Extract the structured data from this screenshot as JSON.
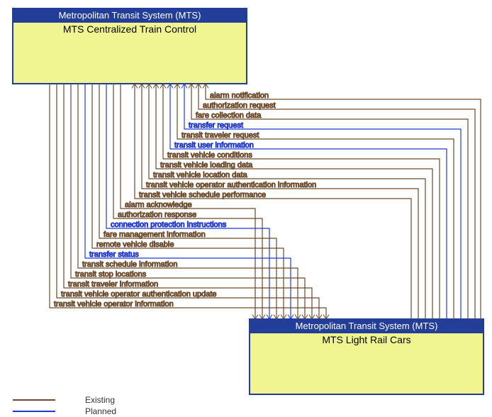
{
  "nodes": {
    "top": {
      "org": "Metropolitan Transit System (MTS)",
      "name": "MTS Centralized Train Control"
    },
    "bottom": {
      "org": "Metropolitan Transit System (MTS)",
      "name": "MTS Light Rail Cars"
    }
  },
  "legend": {
    "existing": "Existing",
    "planned": "Planned"
  },
  "colors": {
    "existing": "#6b4a2b",
    "planned": "#2139d2",
    "header": "#233e99",
    "body": "#f1f58f"
  },
  "flows_to_top": [
    {
      "label": "alarm notification",
      "status": "existing"
    },
    {
      "label": "authorization request",
      "status": "existing"
    },
    {
      "label": "fare collection data",
      "status": "existing"
    },
    {
      "label": "transfer request",
      "status": "planned"
    },
    {
      "label": "transit traveler request",
      "status": "existing"
    },
    {
      "label": "transit user information",
      "status": "planned"
    },
    {
      "label": "transit vehicle conditions",
      "status": "existing"
    },
    {
      "label": "transit vehicle loading data",
      "status": "existing"
    },
    {
      "label": "transit vehicle location data",
      "status": "existing"
    },
    {
      "label": "transit vehicle operator authentication information",
      "status": "existing"
    },
    {
      "label": "transit vehicle schedule performance",
      "status": "existing"
    }
  ],
  "flows_to_bottom": [
    {
      "label": "alarm acknowledge",
      "status": "existing"
    },
    {
      "label": "authorization response",
      "status": "existing"
    },
    {
      "label": "connection protection instructions",
      "status": "planned"
    },
    {
      "label": "fare management information",
      "status": "existing"
    },
    {
      "label": "remote vehicle disable",
      "status": "existing"
    },
    {
      "label": "transfer status",
      "status": "planned"
    },
    {
      "label": "transit schedule information",
      "status": "existing"
    },
    {
      "label": "transit stop locations",
      "status": "existing"
    },
    {
      "label": "transit traveler information",
      "status": "existing"
    },
    {
      "label": "transit vehicle operator authentication update",
      "status": "existing"
    },
    {
      "label": "transit vehicle operator information",
      "status": "existing"
    }
  ]
}
